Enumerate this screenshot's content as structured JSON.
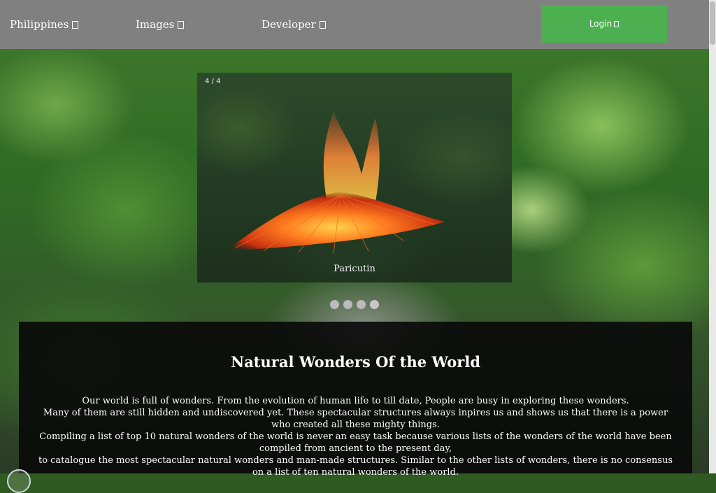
{
  "nav": {
    "items": [
      {
        "label": "Philippines"
      },
      {
        "label": "Images"
      },
      {
        "label": "Developer"
      }
    ],
    "login_label": "Login"
  },
  "slideshow": {
    "counter": "4 / 4",
    "caption": "Paricutin",
    "dot_count": 4,
    "active_index": 3
  },
  "content": {
    "title": "Natural Wonders Of the World",
    "lines": [
      "Our world is full of wonders. From the evolution of human life to till date, People are busy in exploring these wonders.",
      "Many of them are still hidden and undiscovered yet. These spectacular structures always inpires us and shows us that there is a power who created all these mighty things.",
      "Compiling a list of top 10 natural wonders of the world is never an easy task because various lists of the wonders of the world have been compiled from ancient to the present day,",
      "to catalogue the most spectacular natural wonders and man-made structures. Similar to the other lists of wonders, there is no consensus on a list of ten natural wonders of the world."
    ]
  },
  "colors": {
    "navbar_bg": "#808080",
    "login_bg": "#4caf50",
    "content_bg": "#0a0a0a"
  }
}
